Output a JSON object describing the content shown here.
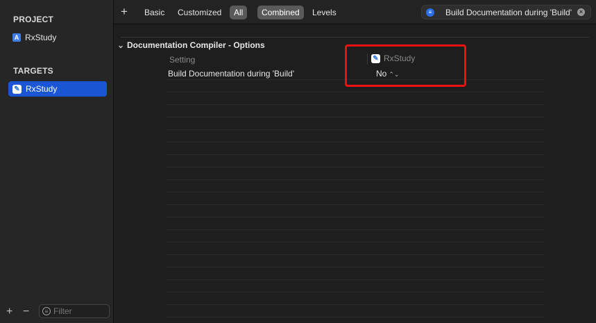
{
  "sidebar": {
    "project_section": "PROJECT",
    "project_item": "RxStudy",
    "targets_section": "TARGETS",
    "target_item": "RxStudy",
    "add_symbol": "+",
    "remove_symbol": "−",
    "filter_placeholder": "Filter"
  },
  "toolbar": {
    "add_symbol": "+",
    "tabs": [
      "Basic",
      "Customized",
      "All",
      "Combined",
      "Levels"
    ],
    "selected_scope": "All",
    "selected_view": "Combined",
    "search_value": "Build Documentation during 'Build'",
    "clear_symbol": "×"
  },
  "settings": {
    "group_title": "Documentation Compiler - Options",
    "column_setting": "Setting",
    "column_target": "RxStudy",
    "row_name": "Build Documentation during 'Build'",
    "row_value": "No"
  },
  "colors": {
    "accent": "#1a55d3",
    "highlight": "#ee1111"
  }
}
